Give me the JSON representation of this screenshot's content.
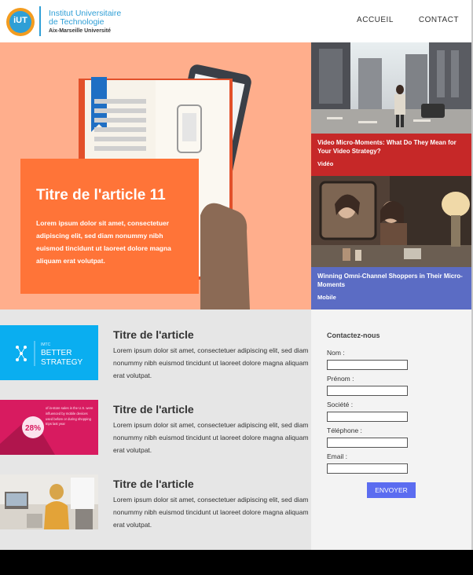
{
  "header": {
    "logo": {
      "badge": "iUT",
      "line1": "Institut Universitaire",
      "line2": "de Technologie",
      "line3": "Aix-Marseille Université"
    },
    "nav": [
      {
        "label": "ACCUEIL"
      },
      {
        "label": "CONTACT"
      }
    ]
  },
  "hero": {
    "title": "Titre de l'article 11",
    "text": "Lorem ipsum dolor sit amet, consectetuer adipiscing elit, sed diam nonummy nibh euismod tincidunt ut laoreet dolore magna aliquam erat volutpat."
  },
  "side_articles": [
    {
      "title": "Video Micro-Moments: What Do They Mean for Your Video Strategy?",
      "tag": "Vidéo"
    },
    {
      "title": "Winning Omni-Channel Shoppers in Their Micro-Moments",
      "tag": "Mobile"
    }
  ],
  "articles": [
    {
      "title": "Titre de l'article",
      "text": "Lorem ipsum dolor sit amet, consectetuer adipiscing elit, sed diam nonummy nibh euismod tincidunt ut laoreet dolore magna aliquam erat volutpat.",
      "thumb_label_small": "IMTC",
      "thumb_label_big1": "BETTER",
      "thumb_label_big2": "STRATEGY"
    },
    {
      "title": "Titre de l'article",
      "text": "Lorem ipsum dolor sit amet, consectetuer adipiscing elit, sed diam nonummy nibh euismod tincidunt ut laoreet dolore magna aliquam erat volutpat.",
      "thumb_percent": "28%",
      "thumb_caption": "of in-store sales in the U.S. were influenced by mobile devices used before or during shopping trips last year"
    },
    {
      "title": "Titre de l'article",
      "text": "Lorem ipsum dolor sit amet, consectetuer adipiscing elit, sed diam nonummy nibh euismod tincidunt ut laoreet dolore magna aliquam erat volutpat."
    }
  ],
  "contact": {
    "title": "Contactez-nous",
    "fields": [
      {
        "label": "Nom :",
        "value": ""
      },
      {
        "label": "Prénom :",
        "value": ""
      },
      {
        "label": "Société :",
        "value": ""
      },
      {
        "label": "Téléphone :",
        "value": ""
      },
      {
        "label": "Email :",
        "value": ""
      }
    ],
    "submit_label": "ENVOYER"
  },
  "colors": {
    "hero_bg": "#ffae8c",
    "hero_card": "#ff7438",
    "side1_caption": "#c62828",
    "side2_caption": "#5b6cc4",
    "submit": "#5b6cf0",
    "brand_blue": "#2f9fd6",
    "brand_orange": "#f39c1f"
  }
}
